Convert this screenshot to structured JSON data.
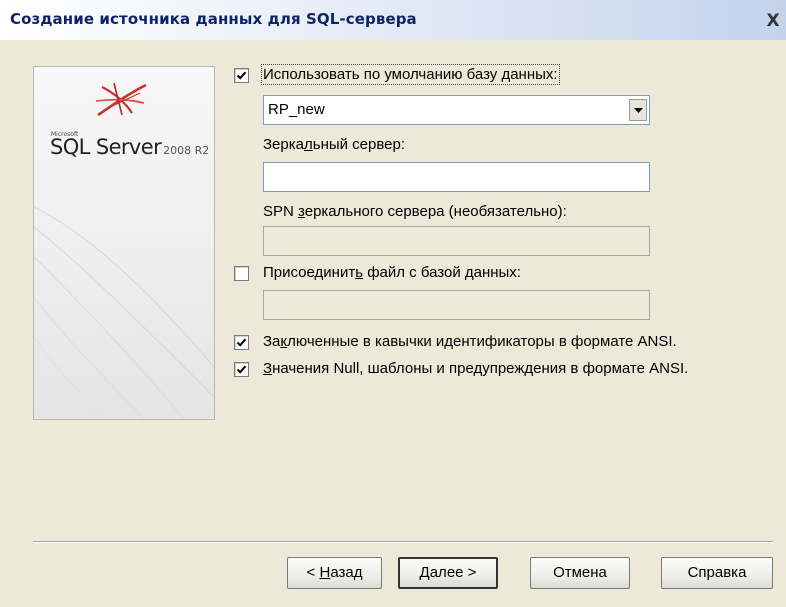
{
  "window": {
    "title": "Создание источника данных для SQL-сервера",
    "close_symbol": "X"
  },
  "logo": {
    "microsoft": "Microsoft",
    "product": "SQL Server",
    "version": "2008 R2"
  },
  "form": {
    "default_db": {
      "checked": true,
      "label": "Использовать по умолчанию базу данных:",
      "value": "RP_new"
    },
    "mirror_server": {
      "label_pre": "Зерка",
      "label_u": "л",
      "label_post": "ьный сервер:",
      "value": ""
    },
    "mirror_spn": {
      "label_pre": "SPN ",
      "label_u": "з",
      "label_post": "еркального сервера (необязательно):",
      "value": ""
    },
    "attach_file": {
      "checked": false,
      "label_pre": "Присоединит",
      "label_u": "ь",
      "label_post": " файл с базой данных:",
      "value": ""
    },
    "ansi_quoted": {
      "checked": true,
      "label_pre": "За",
      "label_u": "к",
      "label_post": "люченные в кавычки идентификаторы в формате ANSI."
    },
    "ansi_nulls": {
      "checked": true,
      "label_u": "З",
      "label_post": "начения Null, шаблоны и предупреждения в формате ANSI."
    }
  },
  "buttons": {
    "back_pre": "< ",
    "back_u": "Н",
    "back_post": "азад",
    "next_u": "Д",
    "next_post": "алее >",
    "cancel": "Отмена",
    "help": "Справка"
  },
  "colors": {
    "title_text": "#0a246a",
    "dialog_bg": "#ece9d8",
    "logo_red": "#c8302c"
  }
}
